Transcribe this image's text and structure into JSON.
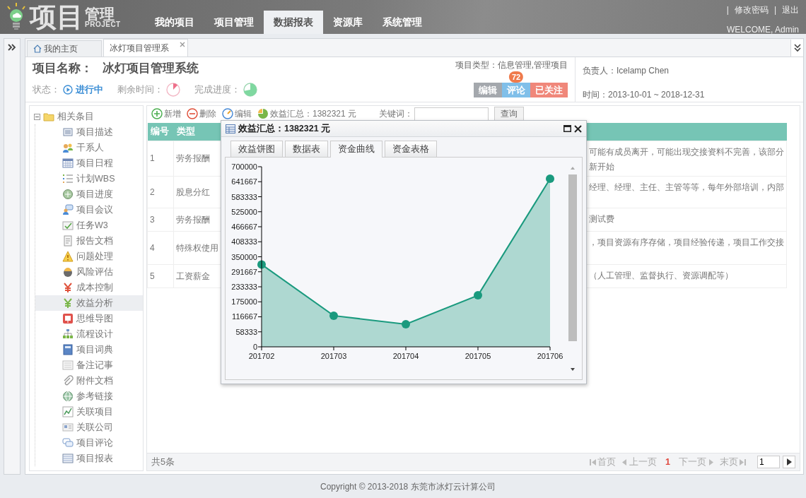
{
  "header": {
    "logo": {
      "main": "项目",
      "sub": "管理",
      "tagline": "PROJECT"
    },
    "nav": [
      {
        "label": "我的项目",
        "selected": false
      },
      {
        "label": "项目管理",
        "selected": false
      },
      {
        "label": "数据报表",
        "selected": true
      },
      {
        "label": "资源库",
        "selected": false
      },
      {
        "label": "系统管理",
        "selected": false
      }
    ],
    "user_links": [
      {
        "separator": "|",
        "label": "修改密码"
      },
      {
        "separator": "|",
        "label": "退出"
      }
    ],
    "welcome": "WELCOME, Admin"
  },
  "tabs": [
    {
      "label": "我的主页",
      "selected": false,
      "closable": false
    },
    {
      "label": "冰灯项目管理系",
      "selected": true,
      "closable": true
    }
  ],
  "project": {
    "name_label": "项目名称：",
    "name": "冰灯项目管理系统",
    "status_label": "状态：",
    "status": "进行中",
    "remaining": {
      "label": "剩余时间："
    },
    "progress": {
      "label": "完成进度："
    },
    "type_label": "项目类型：",
    "type": "信息管理,管理项目",
    "actions": [
      {
        "label": "编辑",
        "color": "#a4a8ad"
      },
      {
        "label": "评论",
        "color": "#80bfe9",
        "badge": "72"
      },
      {
        "label": "已关注",
        "color": "#f0877a"
      }
    ],
    "owner_label": "负责人：",
    "owner": "Icelamp Chen",
    "time_label": "时间：",
    "time": "2013-10-01 ~ 2018-12-31"
  },
  "tree": {
    "label": "相关条目",
    "expanded": true,
    "children": [
      {
        "label": "项目描述",
        "selected": false
      },
      {
        "label": "干系人",
        "selected": false
      },
      {
        "label": "项目日程",
        "selected": false
      },
      {
        "label": "计划WBS",
        "selected": false
      },
      {
        "label": "项目进度",
        "selected": false
      },
      {
        "label": "项目会议",
        "selected": false
      },
      {
        "label": "任务W3",
        "selected": false
      },
      {
        "label": "报告文档",
        "selected": false
      },
      {
        "label": "问题处理",
        "selected": false
      },
      {
        "label": "风险评估",
        "selected": false
      },
      {
        "label": "成本控制",
        "selected": false
      },
      {
        "label": "效益分析",
        "selected": true
      },
      {
        "label": "思维导图",
        "selected": false
      },
      {
        "label": "流程设计",
        "selected": false
      },
      {
        "label": "项目词典",
        "selected": false
      },
      {
        "label": "备注记事",
        "selected": false
      },
      {
        "label": "附件文档",
        "selected": false
      },
      {
        "label": "参考链接",
        "selected": false
      },
      {
        "label": "关联项目",
        "selected": false
      },
      {
        "label": "关联公司",
        "selected": false
      },
      {
        "label": "项目评论",
        "selected": false
      },
      {
        "label": "项目报表",
        "selected": false
      }
    ]
  },
  "toolbar": {
    "buttons": [
      {
        "label": "新增"
      },
      {
        "label": "删除"
      },
      {
        "label": "编辑"
      },
      {
        "label": "效益汇总：1382321 元"
      }
    ],
    "keyword_label": "关键词：",
    "search_button": "查询"
  },
  "table": {
    "columns": [
      "编号",
      "类型"
    ],
    "rows": [
      {
        "no": "1",
        "type": "劳务报酬",
        "description_lines": [
          "可能有成员离开，可能出现交接资料不完善，该部分",
          "新开始"
        ]
      },
      {
        "no": "2",
        "type": "股息分红",
        "description_lines": [
          "经理、经理、主任、主管等等，每年外部培训，内部"
        ]
      },
      {
        "no": "3",
        "type": "劳务报酬",
        "description_lines": [
          "测试费"
        ]
      },
      {
        "no": "4",
        "type": "特殊权使用",
        "description_lines": [
          "，项目资源有序存储，项目经验传递，项目工作交接"
        ]
      },
      {
        "no": "5",
        "type": "工资薪金",
        "description_lines": [
          "（人工管理、监督执行、资源调配等）"
        ]
      }
    ],
    "total": "共5条"
  },
  "pagination": {
    "first": "首页",
    "prev": "上一页",
    "current": "1",
    "next": "下一页",
    "last": "末页",
    "page_input": "1"
  },
  "dialog": {
    "title": "效益汇总：1382321 元",
    "tabs": [
      {
        "label": "效益饼图",
        "selected": false
      },
      {
        "label": "数据表",
        "selected": false
      },
      {
        "label": "资金曲线",
        "selected": true
      },
      {
        "label": "资金表格",
        "selected": false
      }
    ],
    "chart_data": {
      "type": "area",
      "categories": [
        "201702",
        "201703",
        "201704",
        "201705",
        "201706"
      ],
      "series": [
        {
          "color": "#1a9a7e",
          "values": [
            320000,
            121000,
            88000,
            200000,
            653000
          ]
        }
      ],
      "ylim": [
        0,
        700000
      ],
      "yticks": [
        0,
        58333,
        116667,
        175000,
        233333,
        291667,
        350000,
        408333,
        466667,
        525000,
        583333,
        641667,
        700000
      ]
    }
  },
  "footer": "Copyright © 2013-2018 东莞市冰灯云计算公司"
}
